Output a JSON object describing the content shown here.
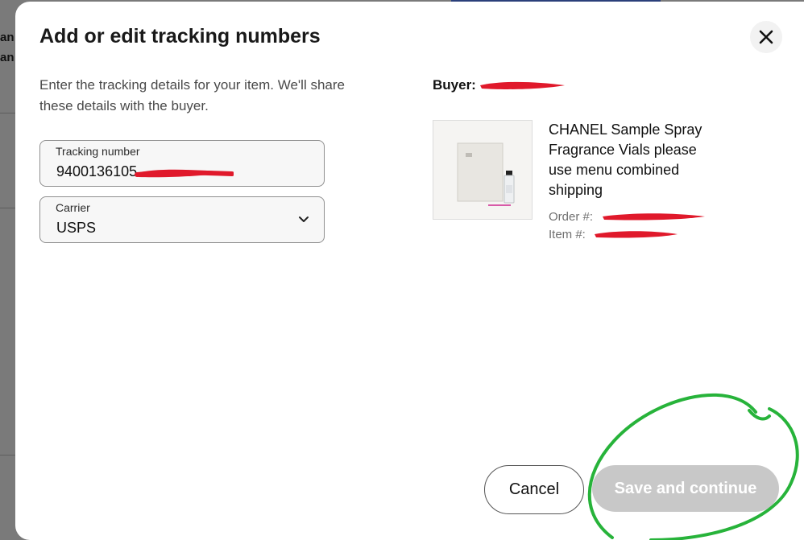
{
  "background": {
    "left_text": [
      "an",
      "an"
    ]
  },
  "modal": {
    "title": "Add or edit tracking numbers",
    "close_icon": "close-icon",
    "intro": "Enter the tracking details for your item. We'll share these details with the buyer."
  },
  "tracking": {
    "label": "Tracking number",
    "value": "9400136105"
  },
  "carrier": {
    "label": "Carrier",
    "value": "USPS",
    "icon": "chevron-down-icon"
  },
  "buyer": {
    "label": "Buyer:"
  },
  "item": {
    "title": "CHANEL Sample Spray Fragrance Vials please use menu combined shipping",
    "order_label": "Order #:",
    "item_label": "Item #:"
  },
  "actions": {
    "cancel": "Cancel",
    "save": "Save and continue"
  },
  "colors": {
    "redaction": "#e0192b",
    "annotation_circle": "#27b33a",
    "disabled_button": "#c8c8c8"
  }
}
